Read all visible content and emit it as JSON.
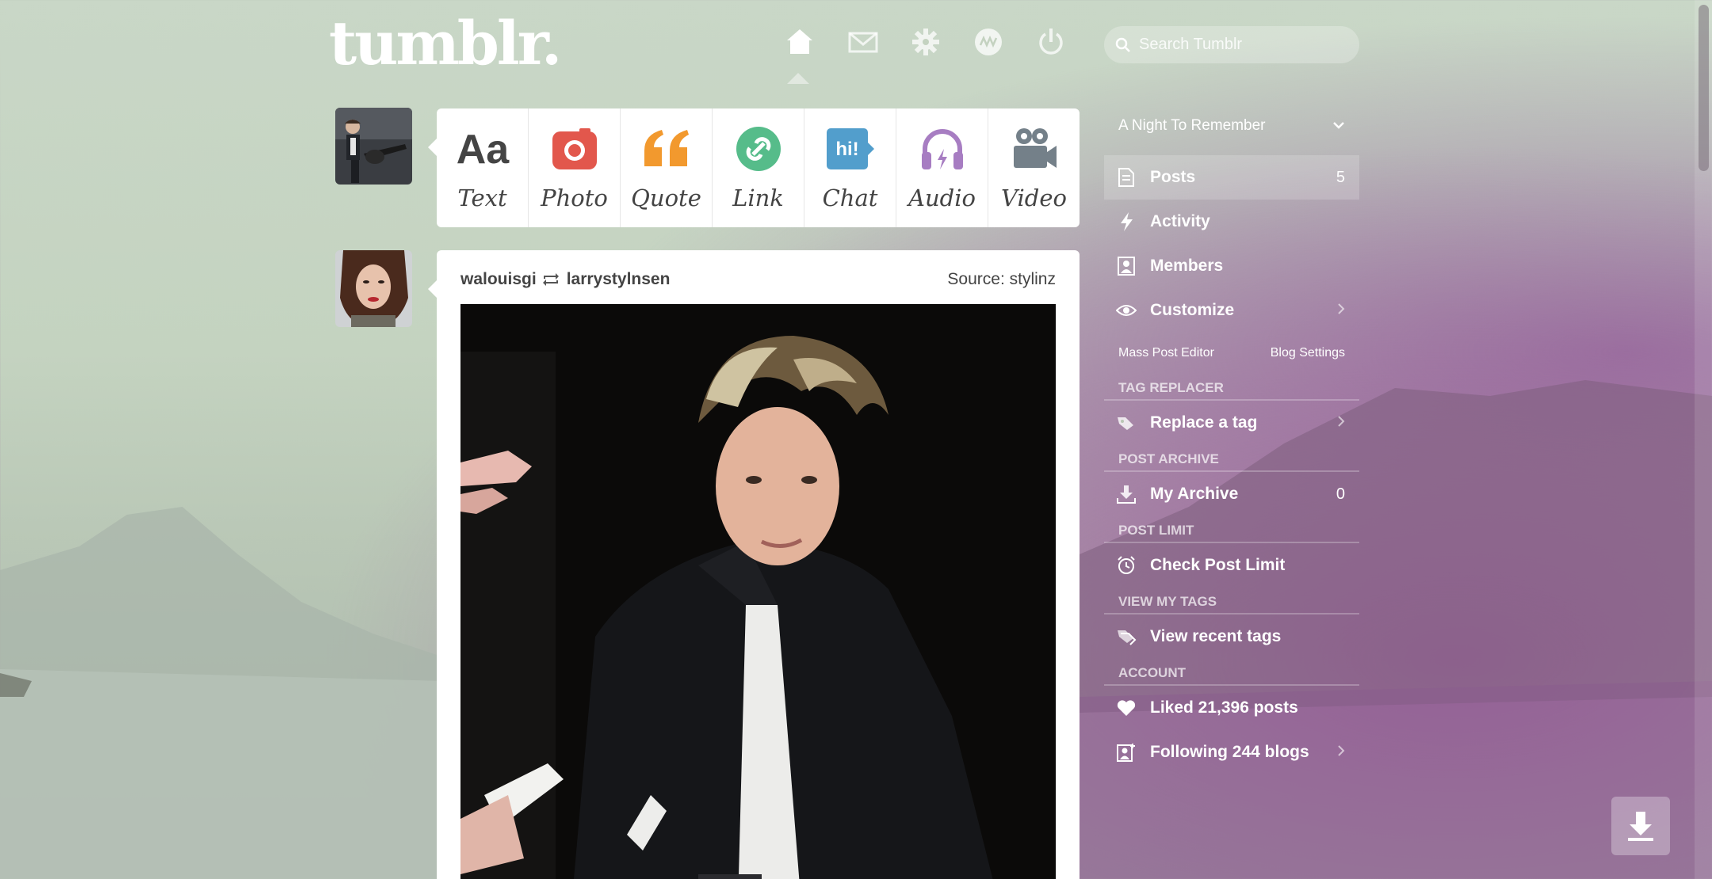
{
  "header": {
    "logo": "tumblr.",
    "search_placeholder": "Search Tumblr",
    "nav": [
      "home-icon",
      "mail-icon",
      "gear-icon",
      "explore-icon",
      "power-icon"
    ]
  },
  "post_types": [
    {
      "label": "Text",
      "icon": "text-icon",
      "color": "#444444"
    },
    {
      "label": "Photo",
      "icon": "camera-icon",
      "color": "#e2574c"
    },
    {
      "label": "Quote",
      "icon": "quote-icon",
      "color": "#f2992e"
    },
    {
      "label": "Link",
      "icon": "link-icon",
      "color": "#56bc8a"
    },
    {
      "label": "Chat",
      "icon": "chat-icon",
      "color": "#529ecc"
    },
    {
      "label": "Audio",
      "icon": "headphones-icon",
      "color": "#a77dc2"
    },
    {
      "label": "Video",
      "icon": "video-camera-icon",
      "color": "#748089"
    }
  ],
  "post": {
    "author": "walouisgi",
    "reblogged_from": "larrystylnsen",
    "source_label": "Source:",
    "source_name": "stylinz"
  },
  "sidebar": {
    "blog_name": "A Night To Remember",
    "items": [
      {
        "label": "Posts",
        "count": "5"
      },
      {
        "label": "Activity"
      },
      {
        "label": "Members"
      },
      {
        "label": "Customize"
      }
    ],
    "links": [
      "Mass Post Editor",
      "Blog Settings"
    ],
    "sections": [
      {
        "heading": "Tag Replacer",
        "item": "Replace a tag"
      },
      {
        "heading": "Post Archive",
        "item": "My Archive",
        "count": "0"
      },
      {
        "heading": "Post Limit",
        "item": "Check Post Limit"
      },
      {
        "heading": "View My Tags",
        "item": "View recent tags"
      },
      {
        "heading": "Account",
        "item": "Liked 21,396 posts"
      }
    ],
    "following": "Following 244 blogs"
  }
}
